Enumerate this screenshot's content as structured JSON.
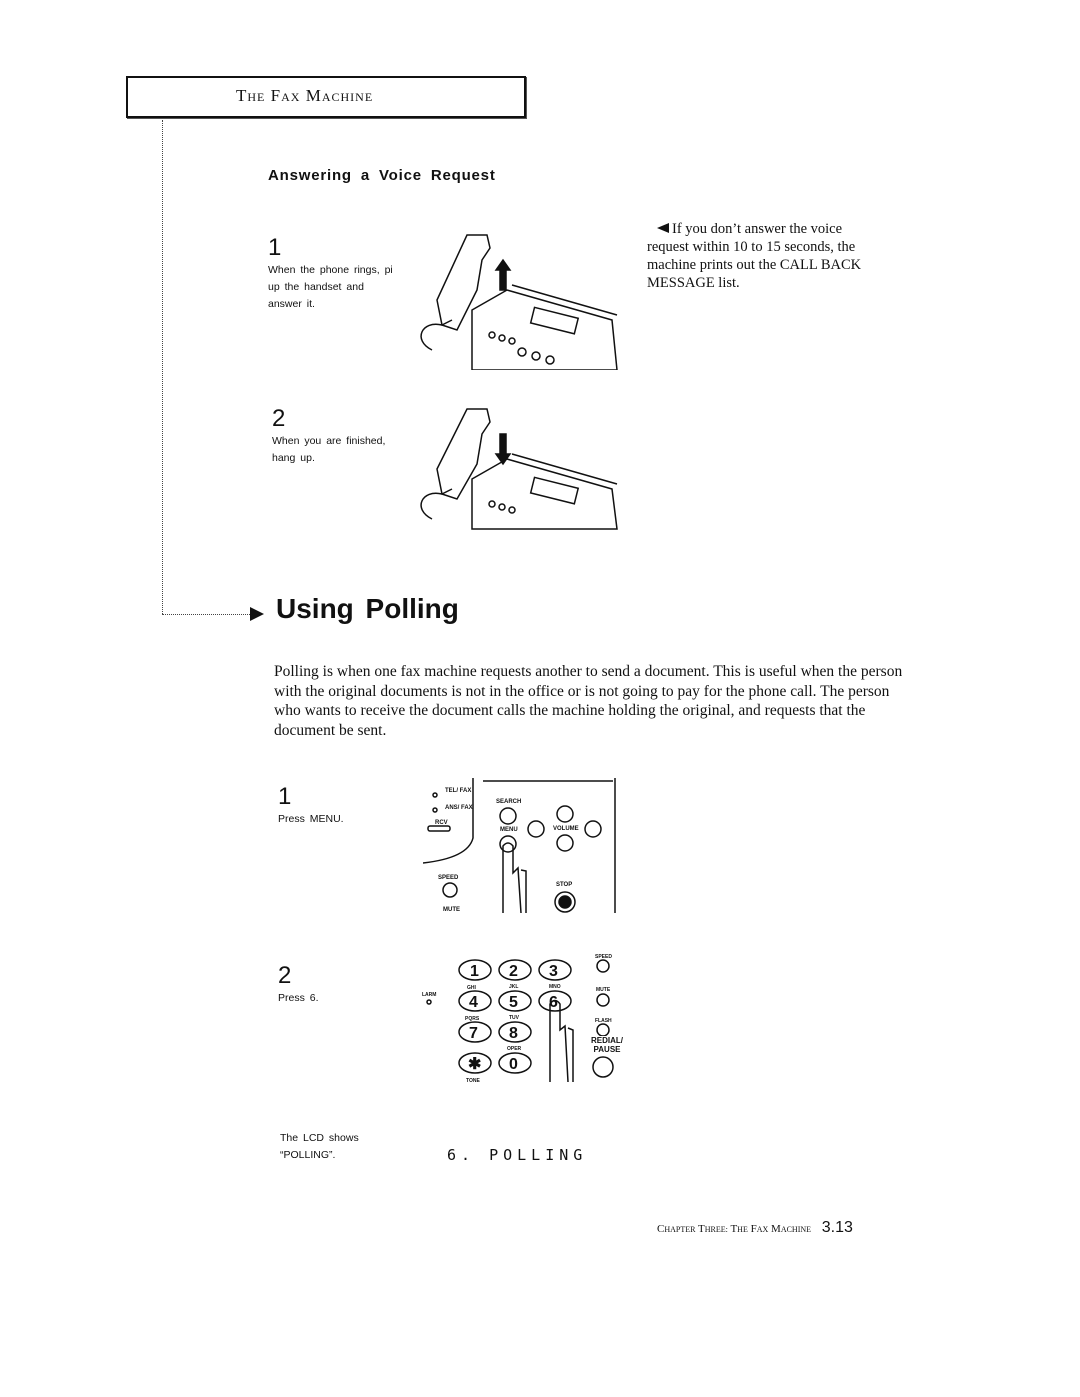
{
  "header": {
    "title_T": "T",
    "title_HE": "HE",
    "title_F": "F",
    "title_AX": "AX",
    "title_M": "M",
    "title_ACHINE": "ACHINE"
  },
  "voice_request": {
    "title": "Answering a Voice Request",
    "steps": [
      {
        "number": "1",
        "text": "When the phone rings, pi up the handset and answer it."
      },
      {
        "number": "2",
        "text": "When you are finished, hang up."
      }
    ],
    "note": "If you don’t answer the voice request within 10 to 15 seconds, the machine prints out the CALL BACK MESSAGE list."
  },
  "polling": {
    "title": "Using Polling",
    "intro": "Polling is when one fax machine requests another to send a document. This is useful when the person with the original documents is not in the office or is not going to pay for the phone call. The person who wants to receive the document calls the machine holding the original, and requests that the document be sent.",
    "steps": [
      {
        "number": "1",
        "text": "Press MENU."
      },
      {
        "number": "2",
        "text": "Press 6."
      }
    ],
    "lcd_caption": "The LCD shows “POLLING”.",
    "lcd_display": "6. POLLING"
  },
  "panel_labels": {
    "tel_fax": "TEL/ FAX",
    "ans_fax": "ANS/ FAX",
    "rcv": "RCV",
    "search": "SEARCH",
    "menu": "MENU",
    "volume": "VOLUME",
    "speed": "SPEED",
    "mute": "MUTE",
    "stop": "STOP"
  },
  "keypad": {
    "keys": [
      "1",
      "2",
      "3",
      "4",
      "5",
      "6",
      "7",
      "8",
      "0"
    ],
    "sub": {
      "ghi": "GHI",
      "jkl": "JKL",
      "mno": "MNO",
      "pqrs": "PQRS",
      "tuv": "TUV",
      "oper": "OPER",
      "tone": "TONE",
      "larm": "LARM"
    },
    "side": {
      "speed": "SPEED",
      "mute": "MUTE",
      "flash": "FLASH",
      "redial": "REDIAL/ PAUSE"
    }
  },
  "footer": {
    "chapter_C": "C",
    "chapter_rest": "HAPTER",
    "three_T": "T",
    "three_rest": "HREE:",
    "the_T": "T",
    "the_rest": "HE",
    "fax_F": "F",
    "fax_rest": "AX",
    "mach_M": "M",
    "mach_rest": "ACHINE",
    "page": "3.13"
  }
}
